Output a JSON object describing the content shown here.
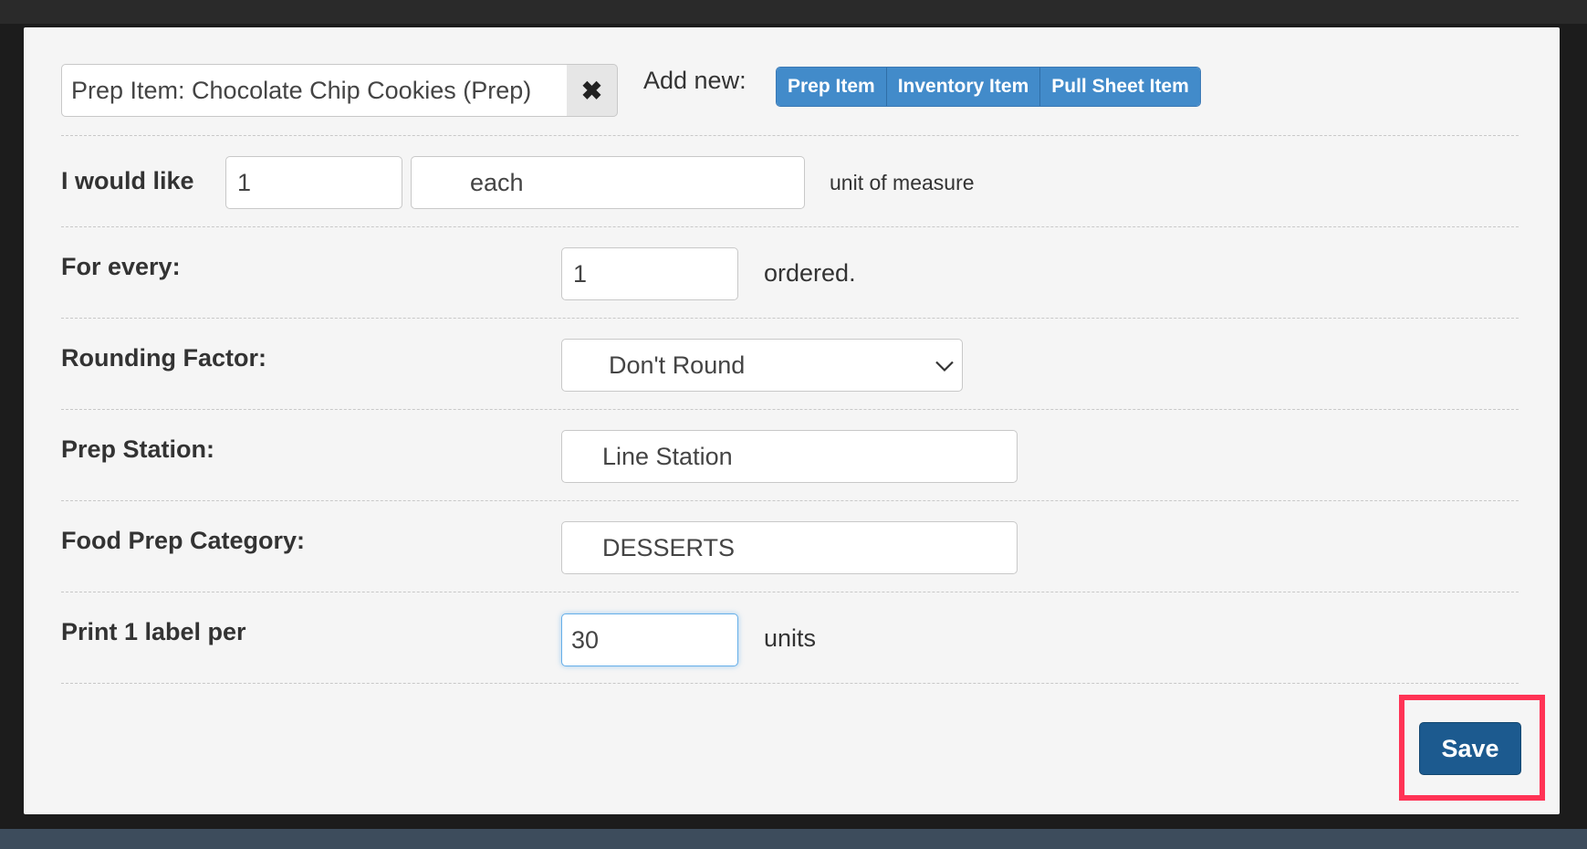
{
  "header": {
    "selected_item": "Prep Item: Chocolate Chip Cookies (Prep)",
    "clear_symbol": "✖",
    "add_new_label": "Add new:",
    "add_new_buttons": [
      "Prep Item",
      "Inventory Item",
      "Pull Sheet Item"
    ]
  },
  "form": {
    "quantity": {
      "label": "I would like",
      "value": "1",
      "unit_value": "each",
      "unit_suffix": "unit of measure"
    },
    "for_every": {
      "label": "For every:",
      "value": "1",
      "suffix": "ordered."
    },
    "rounding": {
      "label": "Rounding Factor:",
      "value": "Don't Round"
    },
    "prep_station": {
      "label": "Prep Station:",
      "value": "Line Station"
    },
    "food_prep_category": {
      "label": "Food Prep Category:",
      "value": "DESSERTS"
    },
    "print_label": {
      "label": "Print 1 label per",
      "value": "30",
      "suffix": "units"
    }
  },
  "footer": {
    "save_label": "Save"
  },
  "colors": {
    "primary": "#428bca",
    "save": "#1c5a8f",
    "highlight": "#ff3355"
  }
}
